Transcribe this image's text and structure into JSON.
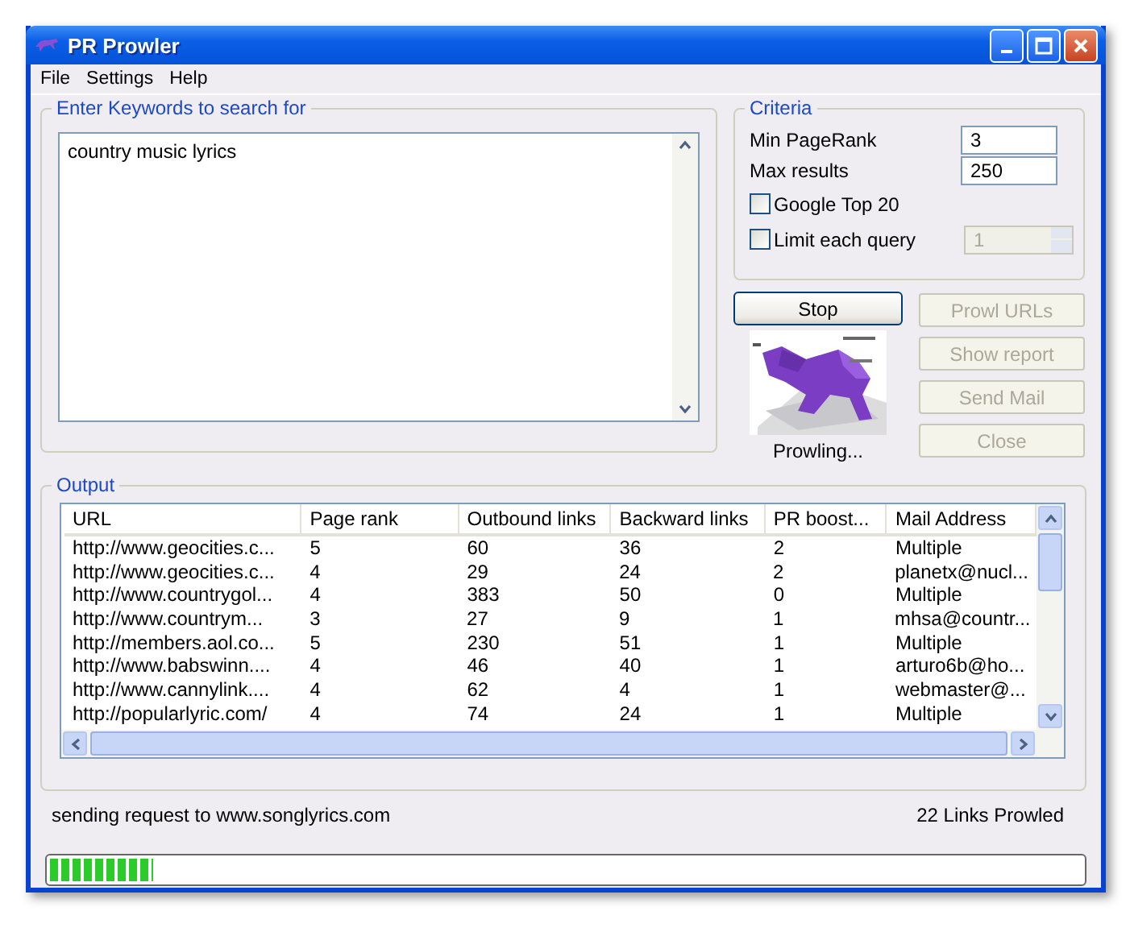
{
  "window": {
    "title": "PR Prowler"
  },
  "menu": [
    "File",
    "Settings",
    "Help"
  ],
  "keywords": {
    "label": "Enter Keywords to search for",
    "value": "country music lyrics"
  },
  "criteria": {
    "label": "Criteria",
    "fields": [
      {
        "label": "Min PageRank",
        "value": "3"
      },
      {
        "label": "Max results",
        "value": "250"
      }
    ],
    "google_top_20": {
      "label": "Google Top 20",
      "checked": false
    },
    "limit_each_query": {
      "label": "Limit each query",
      "checked": false,
      "value": "1",
      "disabled": true
    }
  },
  "stop_button": {
    "label": "Stop",
    "disabled": false
  },
  "buttons": [
    {
      "label": "Prowl URLs",
      "disabled": true
    },
    {
      "label": "Show report",
      "disabled": true
    },
    {
      "label": "Send Mail",
      "disabled": true
    },
    {
      "label": "Close",
      "disabled": true
    }
  ],
  "animation": {
    "kind": "picture",
    "caption": "Prowling..."
  },
  "output": {
    "label": "Output",
    "columns": [
      "URL",
      "Page rank",
      "Outbound links",
      "Backward links",
      "PR boost...",
      "Mail Address"
    ],
    "rows": [
      [
        "http://www.geocities.c...",
        "5",
        "60",
        "36",
        "2",
        "Multiple"
      ],
      [
        "http://www.geocities.c...",
        "4",
        "29",
        "24",
        "2",
        "planetx@nucl..."
      ],
      [
        "http://www.countrygol...",
        "4",
        "383",
        "50",
        "0",
        "Multiple"
      ],
      [
        "http://www.countrym...",
        "3",
        "27",
        "9",
        "1",
        "mhsa@countr..."
      ],
      [
        "http://members.aol.co...",
        "5",
        "230",
        "51",
        "1",
        "Multiple"
      ],
      [
        "http://www.babswinn....",
        "4",
        "46",
        "40",
        "1",
        "arturo6b@ho..."
      ],
      [
        "http://www.cannylink....",
        "4",
        "62",
        "4",
        "1",
        "webmaster@..."
      ],
      [
        "http://popularlyric.com/",
        "4",
        "74",
        "24",
        "1",
        "Multiple"
      ]
    ]
  },
  "status": {
    "message": "sending request to www.songlyrics.com",
    "count": "22 Links Prowled"
  },
  "progress": {
    "level": 0.1
  }
}
